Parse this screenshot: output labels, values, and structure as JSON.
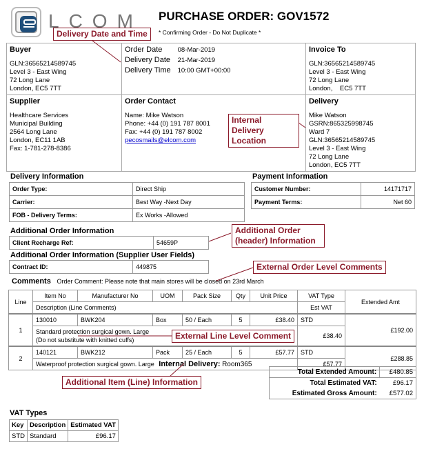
{
  "header": {
    "logo_text": "LCOM",
    "title": "PURCHASE ORDER: GOV1572",
    "subtitle": "* Confirming Order - Do Not Duplicate *"
  },
  "buyer": {
    "heading": "Buyer",
    "lines": [
      "GLN:36565214589745",
      "Level 3 - East Wing",
      "72 Long Lane",
      "London,  EC5 7TT"
    ]
  },
  "order_dates": {
    "rows": [
      {
        "label": "Order Date",
        "value": "08-Mar-2019"
      },
      {
        "label": "Delivery Date",
        "value": "21-Mar-2019"
      },
      {
        "label": "Delivery Time",
        "value": "10:00 GMT+00:00"
      }
    ]
  },
  "invoice_to": {
    "heading": "Invoice To",
    "lines": [
      "GLN:36565214589745",
      "Level 3 - East Wing",
      "72 Long Lane",
      "London,    EC5 7TT"
    ]
  },
  "supplier": {
    "heading": "Supplier",
    "lines": [
      "Healthcare Services",
      "Municipal Building",
      "2564 Long Lane",
      "London,  EC11 1AB",
      "Fax: 1-781-278-8386"
    ]
  },
  "order_contact": {
    "heading": "Order Contact",
    "name": "Name: Mike Watson",
    "phone": "Phone: +44 (0) 191 787 8001",
    "fax": "Fax: +44 (0) 191 787 8002",
    "email": "pecosmails@elcom.com"
  },
  "delivery": {
    "heading": "Delivery",
    "lines": [
      "Mike Watson",
      "GSRN:865325998745",
      "Ward 7",
      "GLN:36565214589745",
      "Level 3 - East Wing",
      "72 Long Lane",
      "London,  EC5 7TT"
    ]
  },
  "delivery_info": {
    "heading": "Delivery Information",
    "rows": [
      {
        "label": "Order Type:",
        "value": "Direct Ship"
      },
      {
        "label": "Carrier:",
        "value": "Best Way  -Next Day"
      },
      {
        "label": "FOB - Delivery Terms:",
        "value": "Ex Works  -Allowed"
      }
    ]
  },
  "payment_info": {
    "heading": "Payment Information",
    "rows": [
      {
        "label": "Customer Number:",
        "value": "14171717"
      },
      {
        "label": "Payment Terms:",
        "value": "Net 60"
      }
    ]
  },
  "additional_order": {
    "heading": "Additional Order Information",
    "label": "Client Recharge Ref:",
    "value": "54659P"
  },
  "supplier_fields": {
    "heading": "Additional Order Information (Supplier User Fields)",
    "label": "Contract ID:",
    "value": "449875"
  },
  "comments": {
    "heading": "Comments",
    "text": "Order Comment: Please note that main stores will be closed on 23rd March"
  },
  "items": {
    "headers": {
      "line": "Line",
      "item_no": "Item No",
      "manufacturer_no": "Manufacturer No",
      "uom": "UOM",
      "pack_size": "Pack Size",
      "qty": "Qty",
      "unit_price": "Unit Price",
      "vat_type": "VAT Type",
      "est_vat": "Est VAT",
      "extended_amt": "Extended Amt",
      "description": "Description (Line Comments)"
    },
    "rows": [
      {
        "line": "1",
        "item_no": "130010",
        "manufacturer_no": "BWK204",
        "uom": "Box",
        "pack_size": "50 / Each",
        "qty": "5",
        "unit_price": "£38.40",
        "vat_type": "STD",
        "est_vat": "£38.40",
        "extended_amt": "£192.00",
        "description": "Standard protection surgical gown. Large",
        "comment": "(Do not substitute with knitted cuffs)"
      },
      {
        "line": "2",
        "item_no": "140121",
        "manufacturer_no": "BWK212",
        "uom": "Pack",
        "pack_size": "25 / Each",
        "qty": "5",
        "unit_price": "£57.77",
        "vat_type": "STD",
        "est_vat": "£57.77",
        "extended_amt": "£288.85",
        "description": "Waterproof protection surgical gown. Large",
        "internal_label": "Internal Delivery:",
        "internal_value": "Room365"
      }
    ]
  },
  "totals": {
    "extended_label": "Total Extended Amount:",
    "extended_value": "£480.85",
    "vat_label": "Total Estimated VAT:",
    "vat_value": "£96.17",
    "gross_label": "Estimated Gross Amount:",
    "gross_value": "£577.02"
  },
  "vat_types": {
    "heading": "VAT Types",
    "headers": [
      "Key",
      "Description",
      "Estimated VAT"
    ],
    "rows": [
      {
        "key": "STD",
        "description": "Standard",
        "estimated_vat": "£96.17"
      }
    ]
  },
  "callouts": {
    "delivery_date_time": "Delivery Date and Time",
    "internal_delivery_location": "Internal Delivery Location",
    "additional_order_header": "Additional Order (header) Information",
    "external_order_comments": "External Order Level Comments",
    "external_line_comment": "External Line Level Comment",
    "additional_item_line": "Additional Item (Line) Information"
  },
  "colors": {
    "callout": "#8b1a2a",
    "logo_blue": "#1f4e7a",
    "link": "#0000cc"
  }
}
